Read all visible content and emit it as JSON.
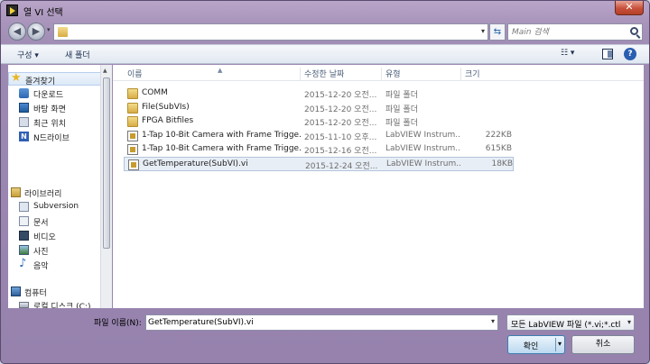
{
  "window": {
    "title": "열 VI 선택",
    "close_glyph": "✕"
  },
  "address": {
    "dropdown_glyph": "▾",
    "refresh_glyph": "⇆",
    "search_placeholder": "Main 검색"
  },
  "toolbar": {
    "organize_label": "구성 ▾",
    "new_folder_label": "새 폴더",
    "view_label": "☷ ▾",
    "help_label": "?"
  },
  "nav": {
    "favorites": {
      "label": "즐겨찾기",
      "items": [
        "다운로드",
        "바탕 화면",
        "최근 위치",
        "N드라이브"
      ]
    },
    "libraries": {
      "label": "라이브러리",
      "items": [
        "Subversion",
        "문서",
        "비디오",
        "사진",
        "음악"
      ]
    },
    "computer": {
      "label": "컴퓨터",
      "items": [
        "로컬 디스크 (C:)"
      ]
    }
  },
  "columns": {
    "name": "이름",
    "date": "수정한 날짜",
    "type": "유형",
    "size": "크기"
  },
  "files": [
    {
      "name": "COMM",
      "date": "2015-12-20 오전...",
      "type": "파일 폴더",
      "size": "",
      "kind": "folder",
      "selected": false
    },
    {
      "name": "File(SubVIs)",
      "date": "2015-12-20 오전...",
      "type": "파일 폴더",
      "size": "",
      "kind": "folder",
      "selected": false
    },
    {
      "name": "FPGA Bitfiles",
      "date": "2015-12-20 오전...",
      "type": "파일 폴더",
      "size": "",
      "kind": "folder",
      "selected": false
    },
    {
      "name": "1-Tap 10-Bit Camera with Frame Trigge...",
      "date": "2015-11-10 오후...",
      "type": "LabVIEW Instrum...",
      "size": "222KB",
      "kind": "vi",
      "selected": false
    },
    {
      "name": "1-Tap 10-Bit Camera with Frame Trigge...",
      "date": "2015-12-16 오전...",
      "type": "LabVIEW Instrum...",
      "size": "615KB",
      "kind": "vi",
      "selected": false
    },
    {
      "name": "GetTemperature(SubVI).vi",
      "date": "2015-12-24 오전...",
      "type": "LabVIEW Instrum...",
      "size": "18KB",
      "kind": "vi",
      "selected": true
    }
  ],
  "bottom": {
    "filename_label": "파일 이름(N):",
    "filename_value": "GetTemperature(SubVI).vi",
    "filter_value": "모든 LabVIEW 파일 (*.vi;*.ctl;*.",
    "ok_label": "확인",
    "cancel_label": "취소"
  }
}
